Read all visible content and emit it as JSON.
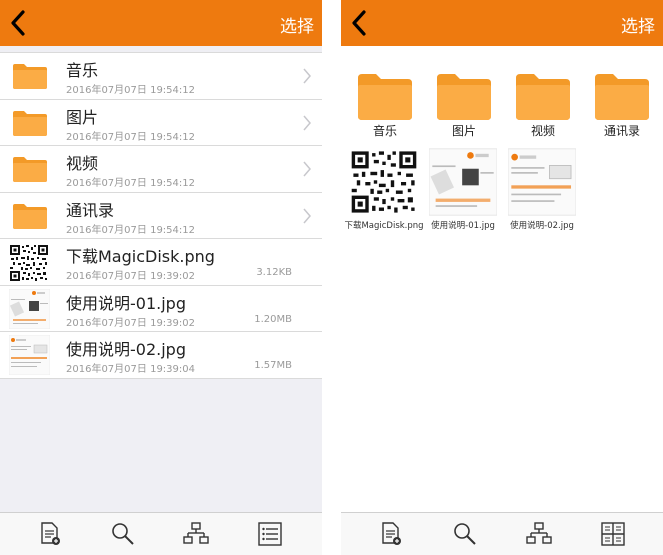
{
  "left_screen": {
    "select_label": "选择",
    "items": [
      {
        "name": "音乐",
        "date": "2016年07月07日 19:54:12",
        "size": "",
        "icon": "folder-icon"
      },
      {
        "name": "图片",
        "date": "2016年07月07日 19:54:12",
        "size": "",
        "icon": "folder-icon"
      },
      {
        "name": "视频",
        "date": "2016年07月07日 19:54:12",
        "size": "",
        "icon": "folder-icon"
      },
      {
        "name": "通讯录",
        "date": "2016年07月07日 19:54:12",
        "size": "",
        "icon": "folder-icon"
      },
      {
        "name": "下载MagicDisk.png",
        "date": "2016年07月07日 19:39:02",
        "size": "3.12KB",
        "icon": "qr-code-thumbnail"
      },
      {
        "name": "使用说明-01.jpg",
        "date": "2016年07月07日 19:39:02",
        "size": "1.20MB",
        "icon": "document-thumbnail"
      },
      {
        "name": "使用说明-02.jpg",
        "date": "2016年07月07日 19:39:04",
        "size": "1.57MB",
        "icon": "document-thumbnail"
      }
    ]
  },
  "right_screen": {
    "select_label": "选择",
    "folders": [
      {
        "name": "音乐"
      },
      {
        "name": "图片"
      },
      {
        "name": "视频"
      },
      {
        "name": "通讯录"
      }
    ],
    "files": [
      {
        "name": "下载MagicDisk.png"
      },
      {
        "name": "使用说明-01.jpg"
      },
      {
        "name": "使用说明-02.jpg"
      }
    ]
  },
  "toolbar_icons": [
    "new-document-icon",
    "search-icon",
    "hierarchy-icon",
    "list-view-icon",
    "grid-view-icon"
  ],
  "colors": {
    "accent": "#ee7a0f",
    "folder": "#f9a43a",
    "background": "#efeff4"
  }
}
